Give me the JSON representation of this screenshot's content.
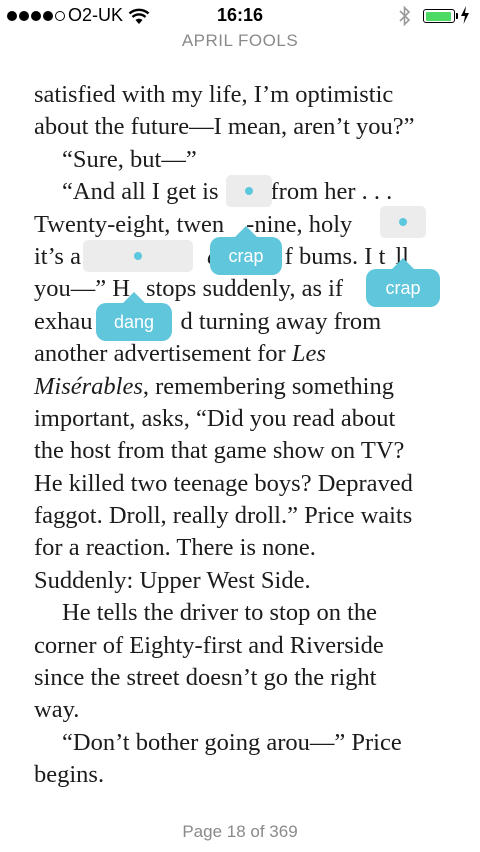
{
  "status_bar": {
    "carrier": "O2-UK",
    "time": "16:16"
  },
  "header": {
    "title": "APRIL FOOLS"
  },
  "text_lines": [
    "satisfied with my life, I’m optimistic",
    "about the future—I mean, aren’t you?”",
    "“Sure, but—”",
    "“And all I get is",
    "from her . . .",
    "Twenty-eight, twen",
    "-nine, holy",
    "it’s a",
    "cl",
    "f bums. I t",
    "ll",
    "you—” H",
    "stops suddenly, as if",
    "exhau",
    "d turning away from",
    "another advertisement for ",
    "Les",
    "Misérables",
    ", remembering something",
    "important, asks, “Did you read about",
    "the host from that game show on TV?",
    "He killed two teenage boys? Depraved",
    "faggot. Droll, really droll.” Price waits",
    "for a reaction. There is none.",
    "Suddenly: Upper West Side.",
    "He tells the driver to stop on the",
    "corner of Eighty-first and Riverside",
    "since the street doesn’t go the right",
    "way.",
    "“Don’t bother going arou—” Price",
    "begins."
  ],
  "replacements": [
    {
      "word": "crap"
    },
    {
      "word": "crap"
    },
    {
      "word": "dang"
    }
  ],
  "footer": {
    "page_label": "Page 18 of 369"
  },
  "colors": {
    "accent": "#5fc6dc",
    "battery": "#4cd964"
  }
}
